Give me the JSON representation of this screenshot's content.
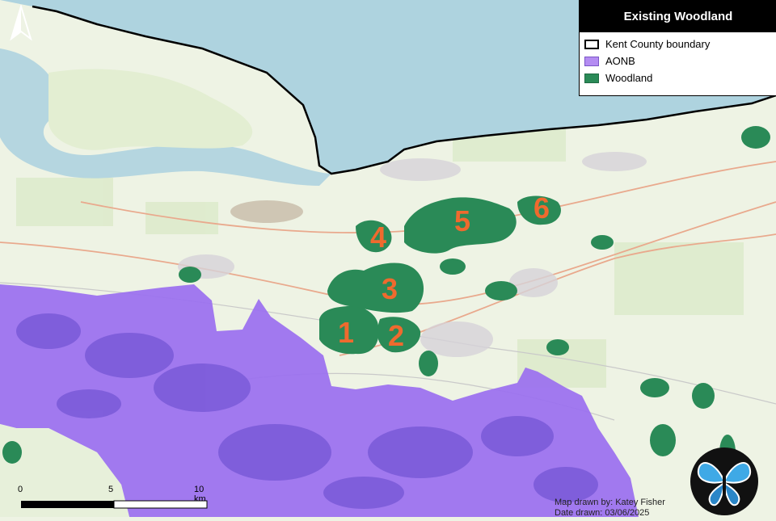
{
  "legend": {
    "title": "Existing Woodland",
    "items": [
      {
        "label": "Kent County boundary",
        "swatch": "boundary"
      },
      {
        "label": "AONB",
        "color": "#b48cf2"
      },
      {
        "label": "Woodland",
        "color": "#2a8a57"
      }
    ]
  },
  "site_numbers": [
    "1",
    "2",
    "3",
    "4",
    "5",
    "6"
  ],
  "north_arrow": {
    "label": "N",
    "icon": "north-arrow-icon"
  },
  "scale_bar": {
    "labels": [
      "0",
      "5",
      "10 km"
    ]
  },
  "credit": {
    "drawn_by": "Map drawn by: Katey Fisher",
    "date": "Date drawn: 03/06/2025"
  },
  "logo": {
    "icon": "butterfly-logo-icon"
  },
  "colors": {
    "sea": "#aed3df",
    "land": "#eef3e4",
    "aonb": "#9a6ff0",
    "woodland": "#2a8a57",
    "labels": "#ef6a2e"
  }
}
